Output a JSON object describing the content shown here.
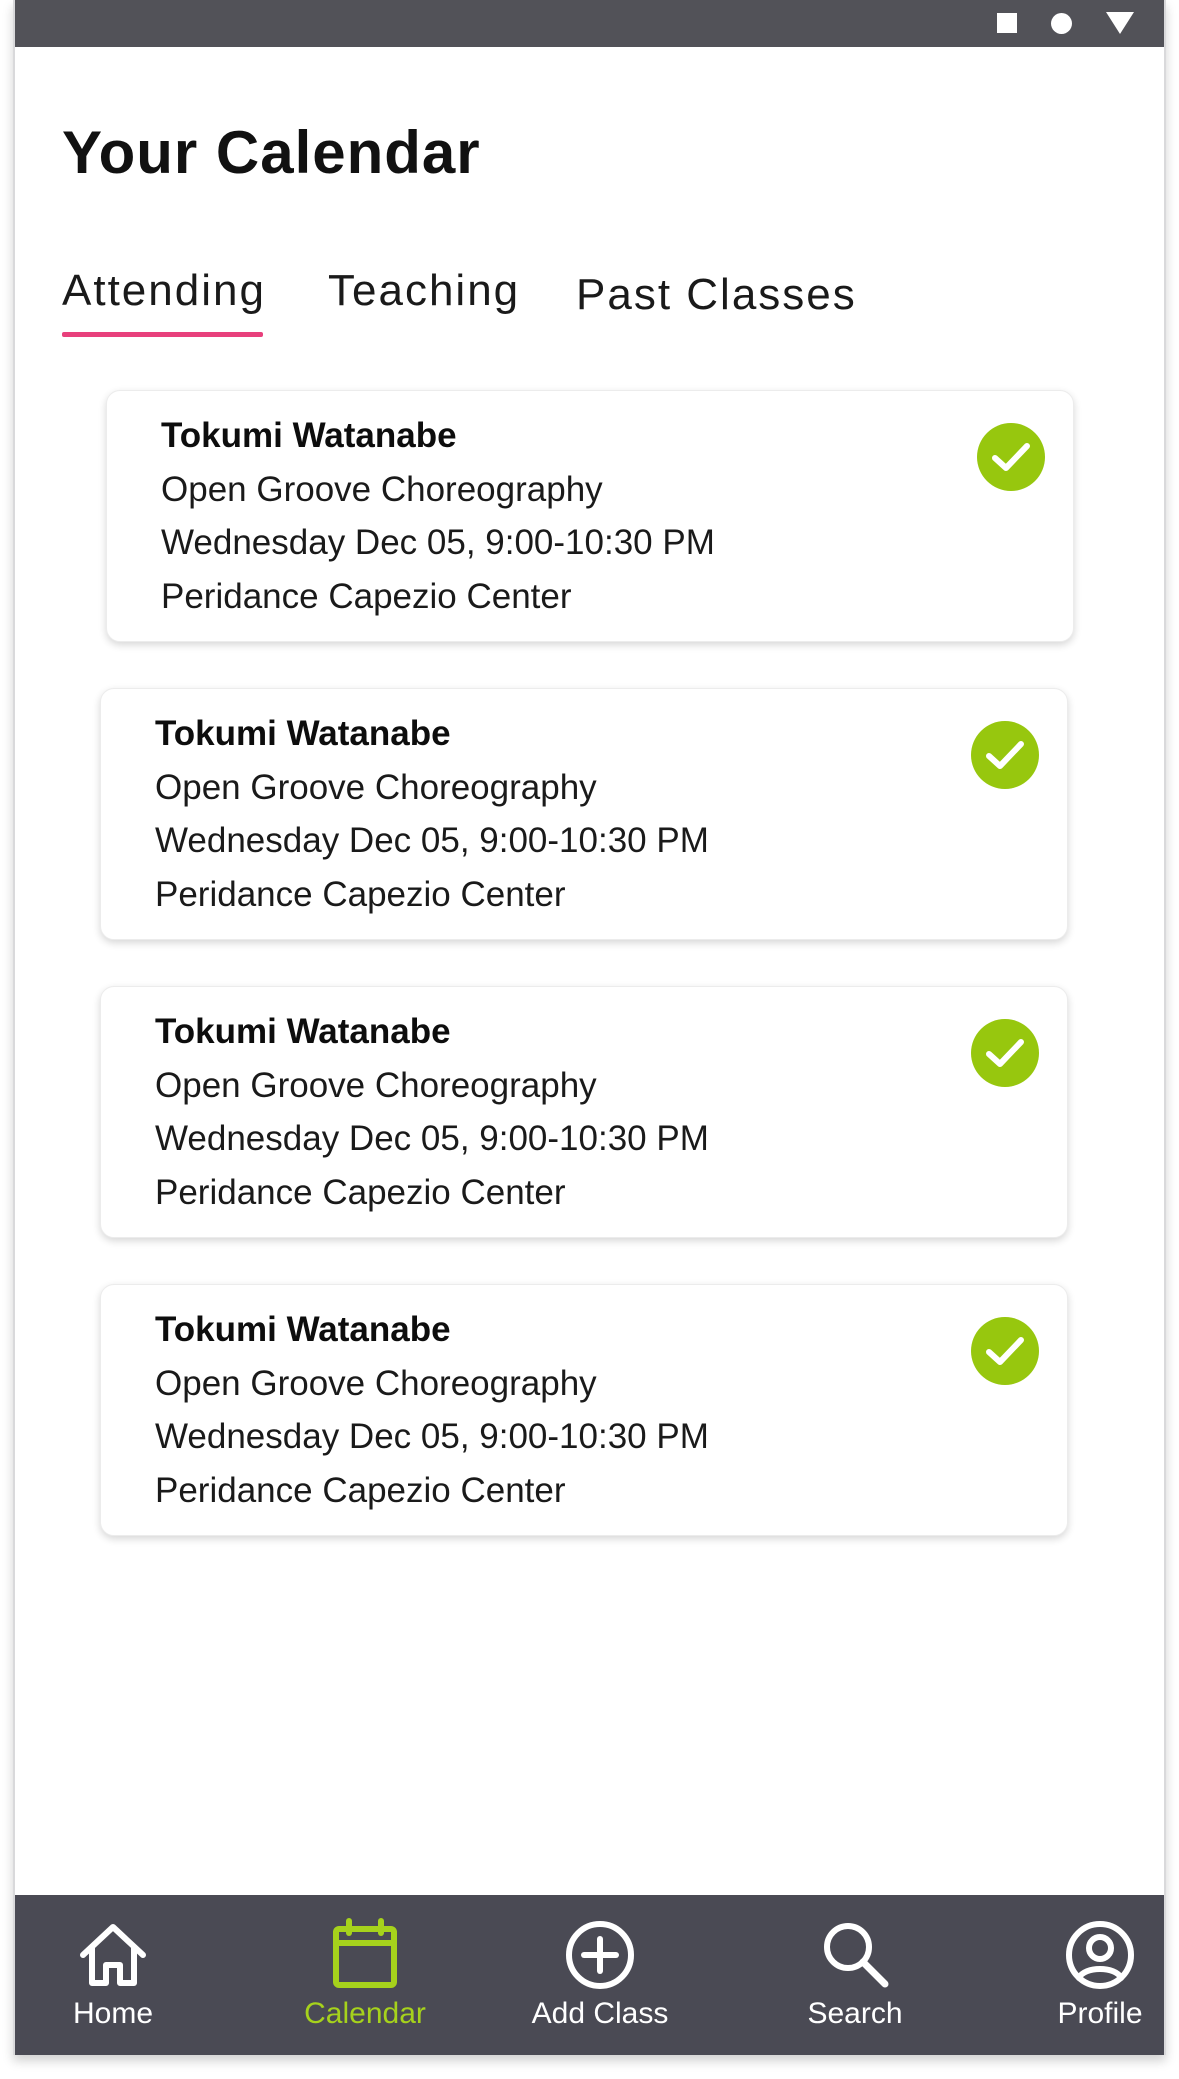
{
  "status_bar": {
    "icons": [
      "square-icon",
      "circle-icon",
      "triangle-icon"
    ]
  },
  "page": {
    "title": "Your Calendar"
  },
  "tabs": [
    {
      "label": "Attending",
      "active": true
    },
    {
      "label": "Teaching",
      "active": false
    },
    {
      "label": "Past Classes",
      "active": false
    }
  ],
  "classes": [
    {
      "instructor": "Tokumi Watanabe",
      "class_name": "Open Groove Choreography",
      "datetime": "Wednesday Dec 05, 9:00-10:30 PM",
      "location": "Peridance Capezio Center",
      "status_icon": "check-circle-icon"
    },
    {
      "instructor": "Tokumi Watanabe",
      "class_name": "Open Groove Choreography",
      "datetime": "Wednesday Dec 05, 9:00-10:30 PM",
      "location": "Peridance Capezio Center",
      "status_icon": "check-circle-icon"
    },
    {
      "instructor": "Tokumi Watanabe",
      "class_name": "Open Groove Choreography",
      "datetime": "Wednesday Dec 05, 9:00-10:30 PM",
      "location": "Peridance Capezio Center",
      "status_icon": "check-circle-icon"
    },
    {
      "instructor": "Tokumi Watanabe",
      "class_name": "Open Groove Choreography",
      "datetime": "Wednesday Dec 05, 9:00-10:30 PM",
      "location": "Peridance Capezio Center",
      "status_icon": "check-circle-icon"
    }
  ],
  "bottom_nav": [
    {
      "label": "Home",
      "icon": "home-icon",
      "active": false
    },
    {
      "label": "Calendar",
      "icon": "calendar-icon",
      "active": true
    },
    {
      "label": "Add Class",
      "icon": "add-circle-icon",
      "active": false
    },
    {
      "label": "Search",
      "icon": "search-icon",
      "active": false
    },
    {
      "label": "Profile",
      "icon": "profile-icon",
      "active": false
    }
  ],
  "colors": {
    "accent_pink": "#e8407c",
    "check_green": "#97c70e",
    "nav_active_green": "#a6d21c",
    "nav_background": "#4a4a54",
    "status_bar_background": "#525258"
  }
}
